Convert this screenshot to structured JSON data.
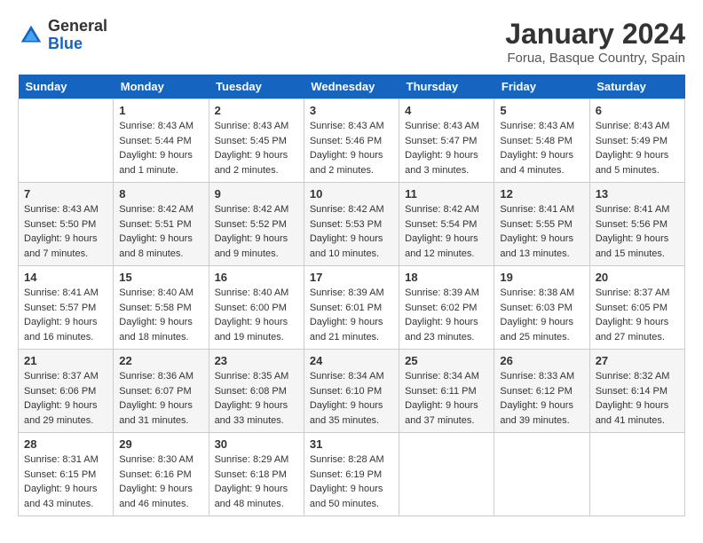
{
  "header": {
    "logo_general": "General",
    "logo_blue": "Blue",
    "month_title": "January 2024",
    "location": "Forua, Basque Country, Spain"
  },
  "days_of_week": [
    "Sunday",
    "Monday",
    "Tuesday",
    "Wednesday",
    "Thursday",
    "Friday",
    "Saturday"
  ],
  "weeks": [
    [
      {
        "day": "",
        "sunrise": "",
        "sunset": "",
        "daylight": ""
      },
      {
        "day": "1",
        "sunrise": "Sunrise: 8:43 AM",
        "sunset": "Sunset: 5:44 PM",
        "daylight": "Daylight: 9 hours and 1 minute."
      },
      {
        "day": "2",
        "sunrise": "Sunrise: 8:43 AM",
        "sunset": "Sunset: 5:45 PM",
        "daylight": "Daylight: 9 hours and 2 minutes."
      },
      {
        "day": "3",
        "sunrise": "Sunrise: 8:43 AM",
        "sunset": "Sunset: 5:46 PM",
        "daylight": "Daylight: 9 hours and 2 minutes."
      },
      {
        "day": "4",
        "sunrise": "Sunrise: 8:43 AM",
        "sunset": "Sunset: 5:47 PM",
        "daylight": "Daylight: 9 hours and 3 minutes."
      },
      {
        "day": "5",
        "sunrise": "Sunrise: 8:43 AM",
        "sunset": "Sunset: 5:48 PM",
        "daylight": "Daylight: 9 hours and 4 minutes."
      },
      {
        "day": "6",
        "sunrise": "Sunrise: 8:43 AM",
        "sunset": "Sunset: 5:49 PM",
        "daylight": "Daylight: 9 hours and 5 minutes."
      }
    ],
    [
      {
        "day": "7",
        "sunrise": "Sunrise: 8:43 AM",
        "sunset": "Sunset: 5:50 PM",
        "daylight": "Daylight: 9 hours and 7 minutes."
      },
      {
        "day": "8",
        "sunrise": "Sunrise: 8:42 AM",
        "sunset": "Sunset: 5:51 PM",
        "daylight": "Daylight: 9 hours and 8 minutes."
      },
      {
        "day": "9",
        "sunrise": "Sunrise: 8:42 AM",
        "sunset": "Sunset: 5:52 PM",
        "daylight": "Daylight: 9 hours and 9 minutes."
      },
      {
        "day": "10",
        "sunrise": "Sunrise: 8:42 AM",
        "sunset": "Sunset: 5:53 PM",
        "daylight": "Daylight: 9 hours and 10 minutes."
      },
      {
        "day": "11",
        "sunrise": "Sunrise: 8:42 AM",
        "sunset": "Sunset: 5:54 PM",
        "daylight": "Daylight: 9 hours and 12 minutes."
      },
      {
        "day": "12",
        "sunrise": "Sunrise: 8:41 AM",
        "sunset": "Sunset: 5:55 PM",
        "daylight": "Daylight: 9 hours and 13 minutes."
      },
      {
        "day": "13",
        "sunrise": "Sunrise: 8:41 AM",
        "sunset": "Sunset: 5:56 PM",
        "daylight": "Daylight: 9 hours and 15 minutes."
      }
    ],
    [
      {
        "day": "14",
        "sunrise": "Sunrise: 8:41 AM",
        "sunset": "Sunset: 5:57 PM",
        "daylight": "Daylight: 9 hours and 16 minutes."
      },
      {
        "day": "15",
        "sunrise": "Sunrise: 8:40 AM",
        "sunset": "Sunset: 5:58 PM",
        "daylight": "Daylight: 9 hours and 18 minutes."
      },
      {
        "day": "16",
        "sunrise": "Sunrise: 8:40 AM",
        "sunset": "Sunset: 6:00 PM",
        "daylight": "Daylight: 9 hours and 19 minutes."
      },
      {
        "day": "17",
        "sunrise": "Sunrise: 8:39 AM",
        "sunset": "Sunset: 6:01 PM",
        "daylight": "Daylight: 9 hours and 21 minutes."
      },
      {
        "day": "18",
        "sunrise": "Sunrise: 8:39 AM",
        "sunset": "Sunset: 6:02 PM",
        "daylight": "Daylight: 9 hours and 23 minutes."
      },
      {
        "day": "19",
        "sunrise": "Sunrise: 8:38 AM",
        "sunset": "Sunset: 6:03 PM",
        "daylight": "Daylight: 9 hours and 25 minutes."
      },
      {
        "day": "20",
        "sunrise": "Sunrise: 8:37 AM",
        "sunset": "Sunset: 6:05 PM",
        "daylight": "Daylight: 9 hours and 27 minutes."
      }
    ],
    [
      {
        "day": "21",
        "sunrise": "Sunrise: 8:37 AM",
        "sunset": "Sunset: 6:06 PM",
        "daylight": "Daylight: 9 hours and 29 minutes."
      },
      {
        "day": "22",
        "sunrise": "Sunrise: 8:36 AM",
        "sunset": "Sunset: 6:07 PM",
        "daylight": "Daylight: 9 hours and 31 minutes."
      },
      {
        "day": "23",
        "sunrise": "Sunrise: 8:35 AM",
        "sunset": "Sunset: 6:08 PM",
        "daylight": "Daylight: 9 hours and 33 minutes."
      },
      {
        "day": "24",
        "sunrise": "Sunrise: 8:34 AM",
        "sunset": "Sunset: 6:10 PM",
        "daylight": "Daylight: 9 hours and 35 minutes."
      },
      {
        "day": "25",
        "sunrise": "Sunrise: 8:34 AM",
        "sunset": "Sunset: 6:11 PM",
        "daylight": "Daylight: 9 hours and 37 minutes."
      },
      {
        "day": "26",
        "sunrise": "Sunrise: 8:33 AM",
        "sunset": "Sunset: 6:12 PM",
        "daylight": "Daylight: 9 hours and 39 minutes."
      },
      {
        "day": "27",
        "sunrise": "Sunrise: 8:32 AM",
        "sunset": "Sunset: 6:14 PM",
        "daylight": "Daylight: 9 hours and 41 minutes."
      }
    ],
    [
      {
        "day": "28",
        "sunrise": "Sunrise: 8:31 AM",
        "sunset": "Sunset: 6:15 PM",
        "daylight": "Daylight: 9 hours and 43 minutes."
      },
      {
        "day": "29",
        "sunrise": "Sunrise: 8:30 AM",
        "sunset": "Sunset: 6:16 PM",
        "daylight": "Daylight: 9 hours and 46 minutes."
      },
      {
        "day": "30",
        "sunrise": "Sunrise: 8:29 AM",
        "sunset": "Sunset: 6:18 PM",
        "daylight": "Daylight: 9 hours and 48 minutes."
      },
      {
        "day": "31",
        "sunrise": "Sunrise: 8:28 AM",
        "sunset": "Sunset: 6:19 PM",
        "daylight": "Daylight: 9 hours and 50 minutes."
      },
      {
        "day": "",
        "sunrise": "",
        "sunset": "",
        "daylight": ""
      },
      {
        "day": "",
        "sunrise": "",
        "sunset": "",
        "daylight": ""
      },
      {
        "day": "",
        "sunrise": "",
        "sunset": "",
        "daylight": ""
      }
    ]
  ]
}
